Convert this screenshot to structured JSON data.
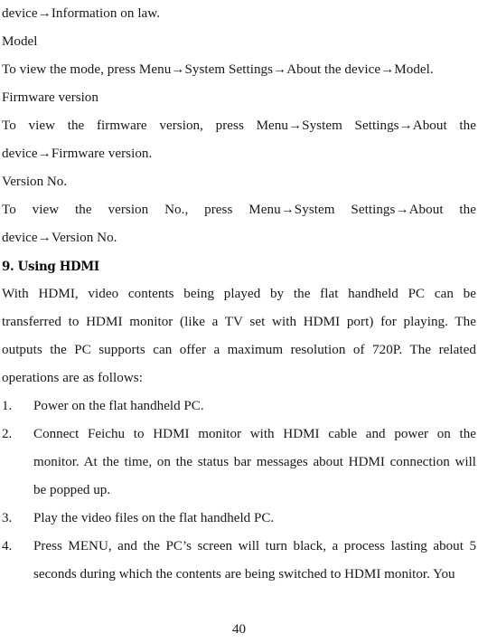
{
  "document": {
    "type": "scanned-manual-page",
    "page_number": "40",
    "text_color": "#18181a",
    "background_color": "#ffffff",
    "blocks": [
      {
        "kind": "paragraph-continuation",
        "lines": [
          "device→Information on law."
        ]
      },
      {
        "kind": "label",
        "lines": [
          "Model"
        ]
      },
      {
        "kind": "paragraph",
        "lines": [
          "To view the mode, press Menu→System Settings→About the device→Model."
        ]
      },
      {
        "kind": "label",
        "lines": [
          "Firmware version"
        ]
      },
      {
        "kind": "paragraph",
        "lines": [
          "To view the firmware version, press Menu→System Settings→About the",
          "device→Firmware version."
        ]
      },
      {
        "kind": "label",
        "lines": [
          "Version No."
        ]
      },
      {
        "kind": "paragraph",
        "lines": [
          "To view the version No., press Menu→System Settings→About the",
          "device→Version No."
        ]
      },
      {
        "kind": "heading",
        "lines": [
          "9. Using HDMI"
        ]
      },
      {
        "kind": "paragraph",
        "lines": [
          "With HDMI, video contents being played by the flat handheld PC can be",
          "transferred to HDMI monitor (like a TV set with HDMI port) for playing. The",
          "outputs the PC supports can offer a maximum resolution of 720P. The related",
          "operations are as follows:"
        ]
      }
    ],
    "list": {
      "items": [
        {
          "number": "1.",
          "lines": [
            "Power on the flat handheld PC."
          ]
        },
        {
          "number": "2.",
          "lines": [
            "Connect Feichu to HDMI monitor with HDMI cable and power on the",
            "monitor. At the time, on the status bar messages about HDMI connection will",
            "be popped up."
          ]
        },
        {
          "number": "3.",
          "lines": [
            "Play the video files on the flat handheld PC."
          ]
        },
        {
          "number": "4.",
          "lines": [
            "Press MENU, and the PC’s screen will turn black, a process lasting about 5",
            "seconds during which the contents are being switched to HDMI monitor. You"
          ]
        }
      ]
    }
  }
}
